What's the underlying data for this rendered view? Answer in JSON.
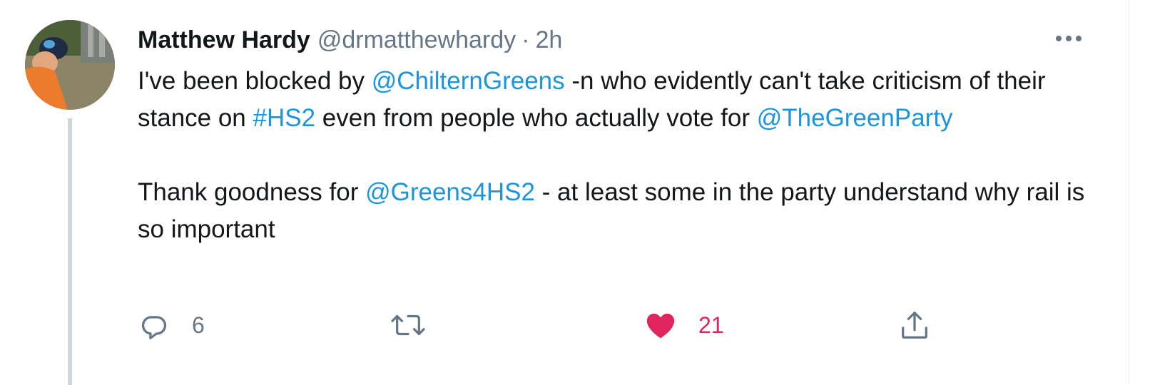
{
  "colors": {
    "link": "#1b95e0",
    "text": "#14171a",
    "secondary": "#657786",
    "like": "#e0245e",
    "thread_line": "#ccd6dd"
  },
  "tweet": {
    "author_name": "Matthew Hardy",
    "author_handle": "@drmatthewhardy",
    "separator": "·",
    "timestamp": "2h",
    "paragraph1": {
      "t1": "I've been blocked by ",
      "mention1": "@ChilternGreens",
      "t2": " -n who evidently can't take criticism of their stance on ",
      "hashtag": "#HS2",
      "t3": " even from people who actually vote for ",
      "mention2": "@TheGreenParty"
    },
    "paragraph2": {
      "t1": "Thank goodness for ",
      "mention": "@Greens4HS2",
      "t2": " - at least some in the party understand why rail is so important"
    },
    "actions": {
      "reply_icon": "reply-icon",
      "reply_count": "6",
      "retweet_icon": "retweet-icon",
      "retweet_count": "",
      "like_icon": "heart-filled-icon",
      "like_count": "21",
      "share_icon": "share-icon"
    }
  }
}
